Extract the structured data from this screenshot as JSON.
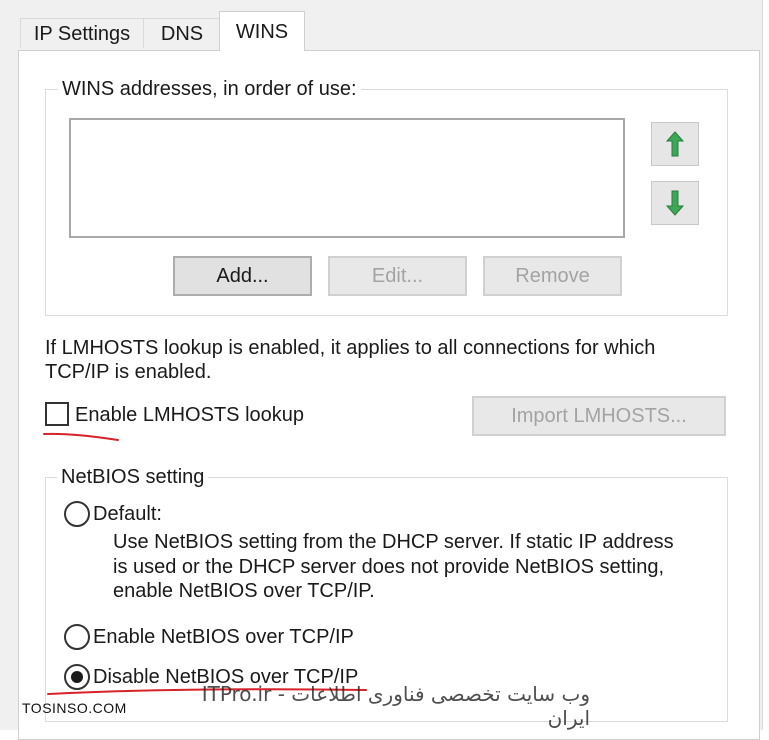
{
  "tabs": [
    {
      "label": "IP Settings",
      "active": false
    },
    {
      "label": "DNS",
      "active": false
    },
    {
      "label": "WINS",
      "active": true
    }
  ],
  "wins_group": {
    "legend": "WINS addresses, in order of use:",
    "addresses": [],
    "buttons": {
      "add": "Add...",
      "edit": "Edit...",
      "remove": "Remove"
    },
    "move_up_icon": "arrow-up-icon",
    "move_down_icon": "arrow-down-icon"
  },
  "lmhosts": {
    "info_line1": "If LMHOSTS lookup is enabled, it applies to all connections for which",
    "info_line2": "TCP/IP is enabled.",
    "checkbox_label": "Enable LMHOSTS lookup",
    "checked": false,
    "import_button": "Import LMHOSTS..."
  },
  "netbios_group": {
    "legend": "NetBIOS setting",
    "options": [
      {
        "label": "Default:",
        "selected": false
      },
      {
        "label": "Enable NetBIOS over TCP/IP",
        "selected": false
      },
      {
        "label": "Disable NetBIOS over TCP/IP",
        "selected": true
      }
    ],
    "default_description": [
      "Use NetBIOS setting from the DHCP server. If static IP address",
      "is used or the DHCP server does not provide NetBIOS setting,",
      "enable NetBIOS over TCP/IP."
    ]
  },
  "watermarks": {
    "left": "TOSINSO.COM",
    "right": "ITPro.ir - وب سایت تخصصی فناوری اطلاعات ایران"
  },
  "colors": {
    "annotation_red": "#d7222a",
    "arrow_green": "#3aa856"
  }
}
